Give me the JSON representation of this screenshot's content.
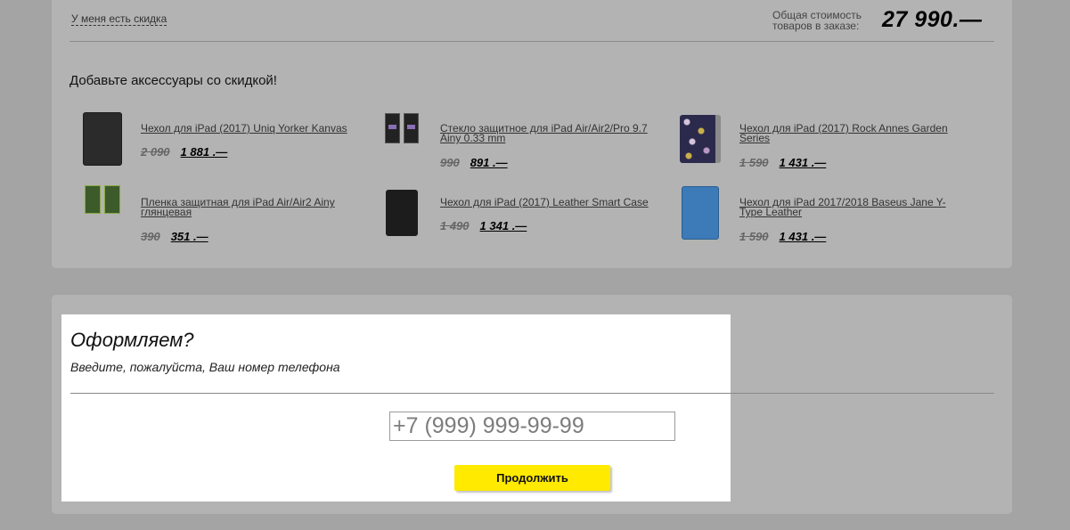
{
  "cart_summary": {
    "discount_link": "У меня есть скидка",
    "total_label_line1": "Общая стоимость",
    "total_label_line2": "товаров в заказе:",
    "total_value": "27 990.—"
  },
  "accessories": {
    "title": "Добавьте аксессуары со скидкой!",
    "items": [
      {
        "name": "Чехол для iPad (2017) Uniq Yorker Kanvas",
        "old_price": "2 090",
        "new_price": "1 881 .—",
        "icon": "dark-case-icon"
      },
      {
        "name": "Стекло защитное для iPad Air/Air2/Pro 9.7 Ainy 0.33 mm",
        "old_price": "990",
        "new_price": "891 .—",
        "icon": "glass-protector-icon"
      },
      {
        "name": "Чехол для iPad (2017) Rock Annes Garden Series",
        "old_price": "1 590",
        "new_price": "1 431 .—",
        "icon": "floral-case-icon"
      },
      {
        "name": "Пленка защитная для iPad Air/Air2 Ainy глянцевая",
        "old_price": "390",
        "new_price": "351 .—",
        "icon": "film-protector-icon"
      },
      {
        "name": "Чехол для iPad (2017) Leather Smart Case",
        "old_price": "1 490",
        "new_price": "1 341 .—",
        "icon": "black-case-icon"
      },
      {
        "name": "Чехол для iPad 2017/2018 Baseus Jane Y-Type Leather",
        "old_price": "1 590",
        "new_price": "1 431 .—",
        "icon": "blue-case-icon"
      }
    ]
  },
  "checkout": {
    "title": "Оформляем?",
    "subtitle": "Введите, пожалуйста, Ваш номер телефона",
    "phone_placeholder": "+7 (999) 999-99-99",
    "continue_label": "Продолжить"
  },
  "colors": {
    "overlay_bg": "#a4a4a4",
    "card_bg": "#b3b3b3",
    "button_yellow": "#ffea00"
  }
}
